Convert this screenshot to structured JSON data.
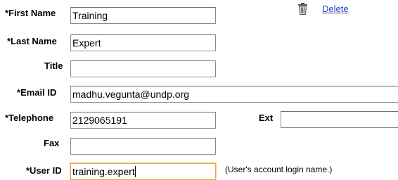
{
  "actions": {
    "delete_label": "Delete",
    "delete_icon": "trash-icon"
  },
  "form": {
    "first_name": {
      "label": "*First Name",
      "value": "Training"
    },
    "last_name": {
      "label": "*Last Name",
      "value": "Expert"
    },
    "title": {
      "label": "Title",
      "value": ""
    },
    "email": {
      "label": "*Email ID",
      "value": "madhu.vegunta@undp.org"
    },
    "telephone": {
      "label": "*Telephone",
      "value": "2129065191"
    },
    "ext": {
      "label": "Ext",
      "value": ""
    },
    "fax": {
      "label": "Fax",
      "value": ""
    },
    "user_id": {
      "label": "*User ID",
      "value": "training.expert",
      "hint": "(User's account login name.)"
    }
  },
  "colors": {
    "link": "#2b3fbf",
    "focus_border": "#e3a64a",
    "field_border": "#8a8a8a"
  }
}
